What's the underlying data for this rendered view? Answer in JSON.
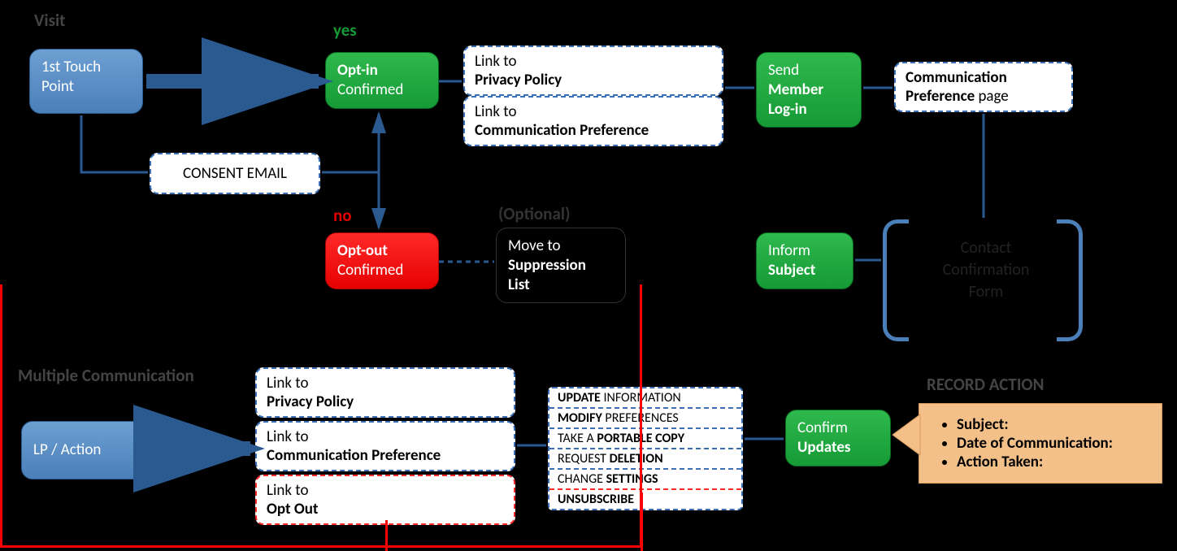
{
  "labels": {
    "visit": "Visit",
    "yes": "yes",
    "no": "no",
    "optional": "(Optional)",
    "multiple": "Multiple Communication",
    "record": "RECORD ACTION"
  },
  "nodes": {
    "firstTouch": "1st Touch Point",
    "consentEmail": "CONSENT EMAIL",
    "optIn_l1": "Opt-in",
    "optIn_l2": "Confirmed",
    "optOut_l1": "Opt-out",
    "optOut_l2": "Confirmed",
    "linkPrivacy_l1": "Link to",
    "linkPrivacy_l2": "Privacy Policy",
    "linkCommPref_l1": "Link to",
    "linkCommPref_l2": "Communication Preference",
    "sendLogin_l1": "Send",
    "sendLogin_l2": "Member",
    "sendLogin_l3": "Log-in",
    "commPrefPage_l1": "Communication",
    "commPrefPage_l2": "Preference",
    "commPrefPage_l2b": "page",
    "suppress_l1": "Move to",
    "suppress_l2": "Suppression",
    "suppress_l3": "List",
    "informSubject_l1": "Inform",
    "informSubject_l2": "Subject",
    "contactConf_l1": "Contact",
    "contactConf_l2": "Confirmation",
    "contactConf_l3": "Form",
    "lpAction": "LP / Action",
    "linkOptOut_l1": "Link to",
    "linkOptOut_l2": "Opt Out",
    "confirmUpd_l1": "Confirm",
    "confirmUpd_l2": "Updates"
  },
  "table": {
    "r1a": "UPDATE",
    "r1b": " INFORMATION",
    "r2a": "MODIFY",
    "r2b": " PREFERENCES",
    "r3a": "TAKE A ",
    "r3b": "PORTABLE COPY",
    "r4a": "REQUEST ",
    "r4b": "DELETION",
    "r5a": "CHANGE ",
    "r5b": "SETTINGS",
    "r6a": "UNSUBSCRIBE"
  },
  "note": {
    "subject": "Subject:",
    "date": "Date of Communication:",
    "action": "Action Taken:"
  }
}
